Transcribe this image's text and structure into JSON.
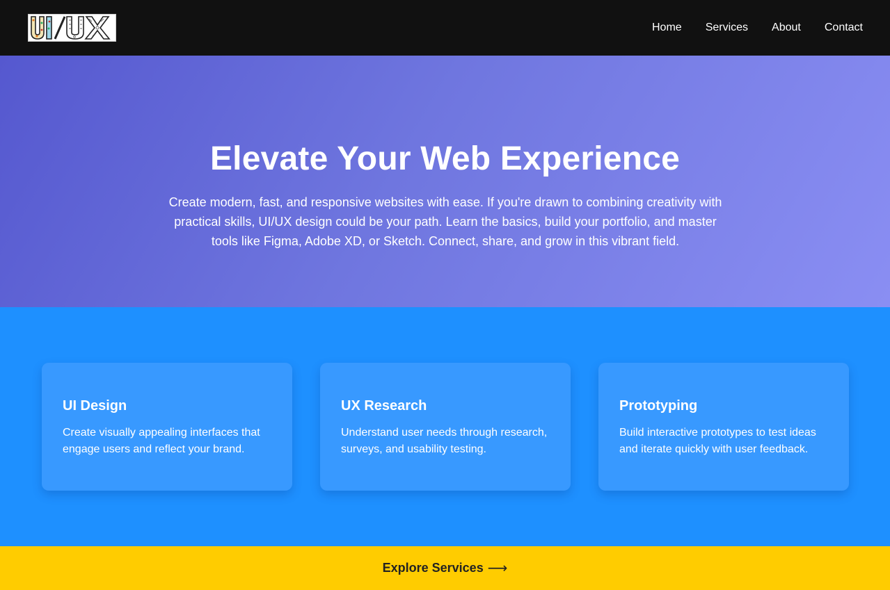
{
  "colors": {
    "navbar_bg": "#111111",
    "hero_gradient_start": "#5558cf",
    "hero_gradient_end": "#8a8ef3",
    "services_bg": "#1e90ff",
    "card_bg": "#3899ff",
    "cta_bg": "#ffcc00"
  },
  "logo": {
    "text": "UI/UX",
    "icon": "ui-ux-logo-icon"
  },
  "nav": {
    "items": [
      {
        "label": "Home"
      },
      {
        "label": "Services"
      },
      {
        "label": "About"
      },
      {
        "label": "Contact"
      }
    ]
  },
  "hero": {
    "title": "Elevate Your Web Experience",
    "text": "Create modern, fast, and responsive websites with ease. If you're drawn to combining creativity with practical skills, UI/UX design could be your path. Learn the basics, build your portfolio, and master tools like Figma, Adobe XD, or Sketch. Connect, share, and grow in this vibrant field."
  },
  "services": {
    "cards": [
      {
        "title": "UI Design",
        "text": "Create visually appealing interfaces that engage users and reflect your brand."
      },
      {
        "title": "UX Research",
        "text": "Understand user needs through research, surveys, and usability testing."
      },
      {
        "title": "Prototyping",
        "text": "Build interactive prototypes to test ideas and iterate quickly with user feedback."
      }
    ]
  },
  "cta": {
    "label": "Explore Services",
    "arrow": "⟶",
    "icon": "arrow-right-icon"
  }
}
